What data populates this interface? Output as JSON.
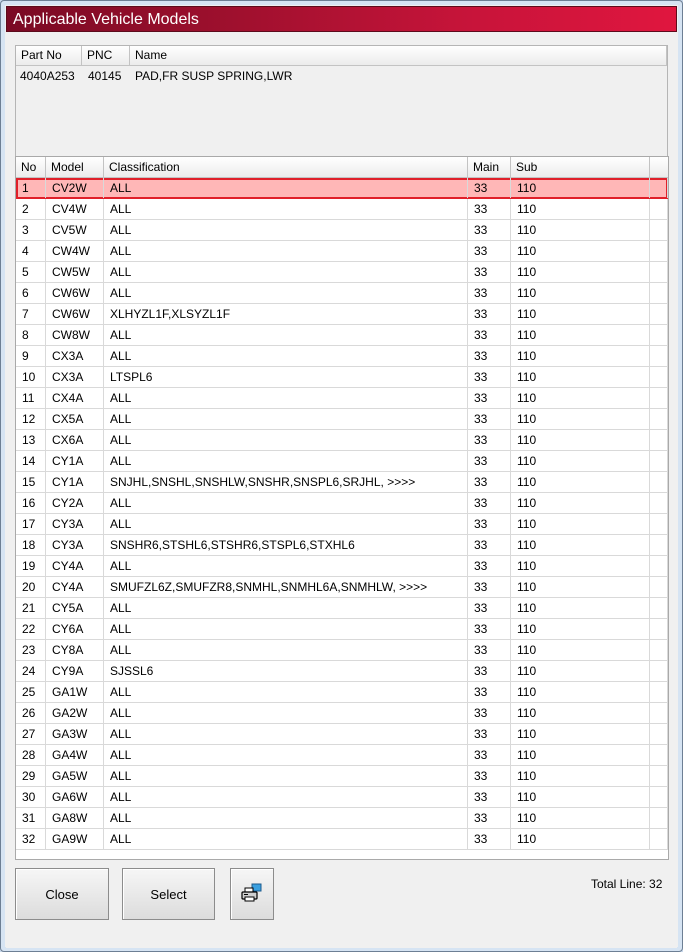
{
  "window": {
    "title": "Applicable Vehicle Models"
  },
  "part_list": {
    "columns": [
      "Part No",
      "PNC",
      "Name"
    ],
    "rows": [
      {
        "part_no": "4040A253",
        "pnc": "40145",
        "name": "PAD,FR SUSP SPRING,LWR"
      }
    ]
  },
  "models_table": {
    "columns": [
      "No",
      "Model",
      "Classification",
      "Main",
      "Sub"
    ],
    "selected_row": 1,
    "rows": [
      {
        "no": "1",
        "model": "CV2W",
        "classification": "ALL",
        "main": "33",
        "sub": "110"
      },
      {
        "no": "2",
        "model": "CV4W",
        "classification": "ALL",
        "main": "33",
        "sub": "110"
      },
      {
        "no": "3",
        "model": "CV5W",
        "classification": "ALL",
        "main": "33",
        "sub": "110"
      },
      {
        "no": "4",
        "model": "CW4W",
        "classification": "ALL",
        "main": "33",
        "sub": "110"
      },
      {
        "no": "5",
        "model": "CW5W",
        "classification": "ALL",
        "main": "33",
        "sub": "110"
      },
      {
        "no": "6",
        "model": "CW6W",
        "classification": "ALL",
        "main": "33",
        "sub": "110"
      },
      {
        "no": "7",
        "model": "CW6W",
        "classification": "XLHYZL1F,XLSYZL1F",
        "main": "33",
        "sub": "110"
      },
      {
        "no": "8",
        "model": "CW8W",
        "classification": "ALL",
        "main": "33",
        "sub": "110"
      },
      {
        "no": "9",
        "model": "CX3A",
        "classification": "ALL",
        "main": "33",
        "sub": "110"
      },
      {
        "no": "10",
        "model": "CX3A",
        "classification": "LTSPL6",
        "main": "33",
        "sub": "110"
      },
      {
        "no": "11",
        "model": "CX4A",
        "classification": "ALL",
        "main": "33",
        "sub": "110"
      },
      {
        "no": "12",
        "model": "CX5A",
        "classification": "ALL",
        "main": "33",
        "sub": "110"
      },
      {
        "no": "13",
        "model": "CX6A",
        "classification": "ALL",
        "main": "33",
        "sub": "110"
      },
      {
        "no": "14",
        "model": "CY1A",
        "classification": "ALL",
        "main": "33",
        "sub": "110"
      },
      {
        "no": "15",
        "model": "CY1A",
        "classification": "SNJHL,SNSHL,SNSHLW,SNSHR,SNSPL6,SRJHL,  >>>>",
        "main": "33",
        "sub": "110"
      },
      {
        "no": "16",
        "model": "CY2A",
        "classification": "ALL",
        "main": "33",
        "sub": "110"
      },
      {
        "no": "17",
        "model": "CY3A",
        "classification": "ALL",
        "main": "33",
        "sub": "110"
      },
      {
        "no": "18",
        "model": "CY3A",
        "classification": "SNSHR6,STSHL6,STSHR6,STSPL6,STXHL6",
        "main": "33",
        "sub": "110"
      },
      {
        "no": "19",
        "model": "CY4A",
        "classification": "ALL",
        "main": "33",
        "sub": "110"
      },
      {
        "no": "20",
        "model": "CY4A",
        "classification": "SMUFZL6Z,SMUFZR8,SNMHL,SNMHL6A,SNMHLW,  >>>>",
        "main": "33",
        "sub": "110"
      },
      {
        "no": "21",
        "model": "CY5A",
        "classification": "ALL",
        "main": "33",
        "sub": "110"
      },
      {
        "no": "22",
        "model": "CY6A",
        "classification": "ALL",
        "main": "33",
        "sub": "110"
      },
      {
        "no": "23",
        "model": "CY8A",
        "classification": "ALL",
        "main": "33",
        "sub": "110"
      },
      {
        "no": "24",
        "model": "CY9A",
        "classification": "SJSSL6",
        "main": "33",
        "sub": "110"
      },
      {
        "no": "25",
        "model": "GA1W",
        "classification": "ALL",
        "main": "33",
        "sub": "110"
      },
      {
        "no": "26",
        "model": "GA2W",
        "classification": "ALL",
        "main": "33",
        "sub": "110"
      },
      {
        "no": "27",
        "model": "GA3W",
        "classification": "ALL",
        "main": "33",
        "sub": "110"
      },
      {
        "no": "28",
        "model": "GA4W",
        "classification": "ALL",
        "main": "33",
        "sub": "110"
      },
      {
        "no": "29",
        "model": "GA5W",
        "classification": "ALL",
        "main": "33",
        "sub": "110"
      },
      {
        "no": "30",
        "model": "GA6W",
        "classification": "ALL",
        "main": "33",
        "sub": "110"
      },
      {
        "no": "31",
        "model": "GA8W",
        "classification": "ALL",
        "main": "33",
        "sub": "110"
      },
      {
        "no": "32",
        "model": "GA9W",
        "classification": "ALL",
        "main": "33",
        "sub": "110"
      }
    ]
  },
  "buttons": {
    "close_label": "Close",
    "select_label": "Select",
    "print_icon": "printer-icon"
  },
  "status": {
    "total_line": "Total Line: 32"
  },
  "colors": {
    "title_bar": "#c8143a",
    "selected_row_bg": "#ffb7b7",
    "selected_row_border": "#e0202a"
  }
}
